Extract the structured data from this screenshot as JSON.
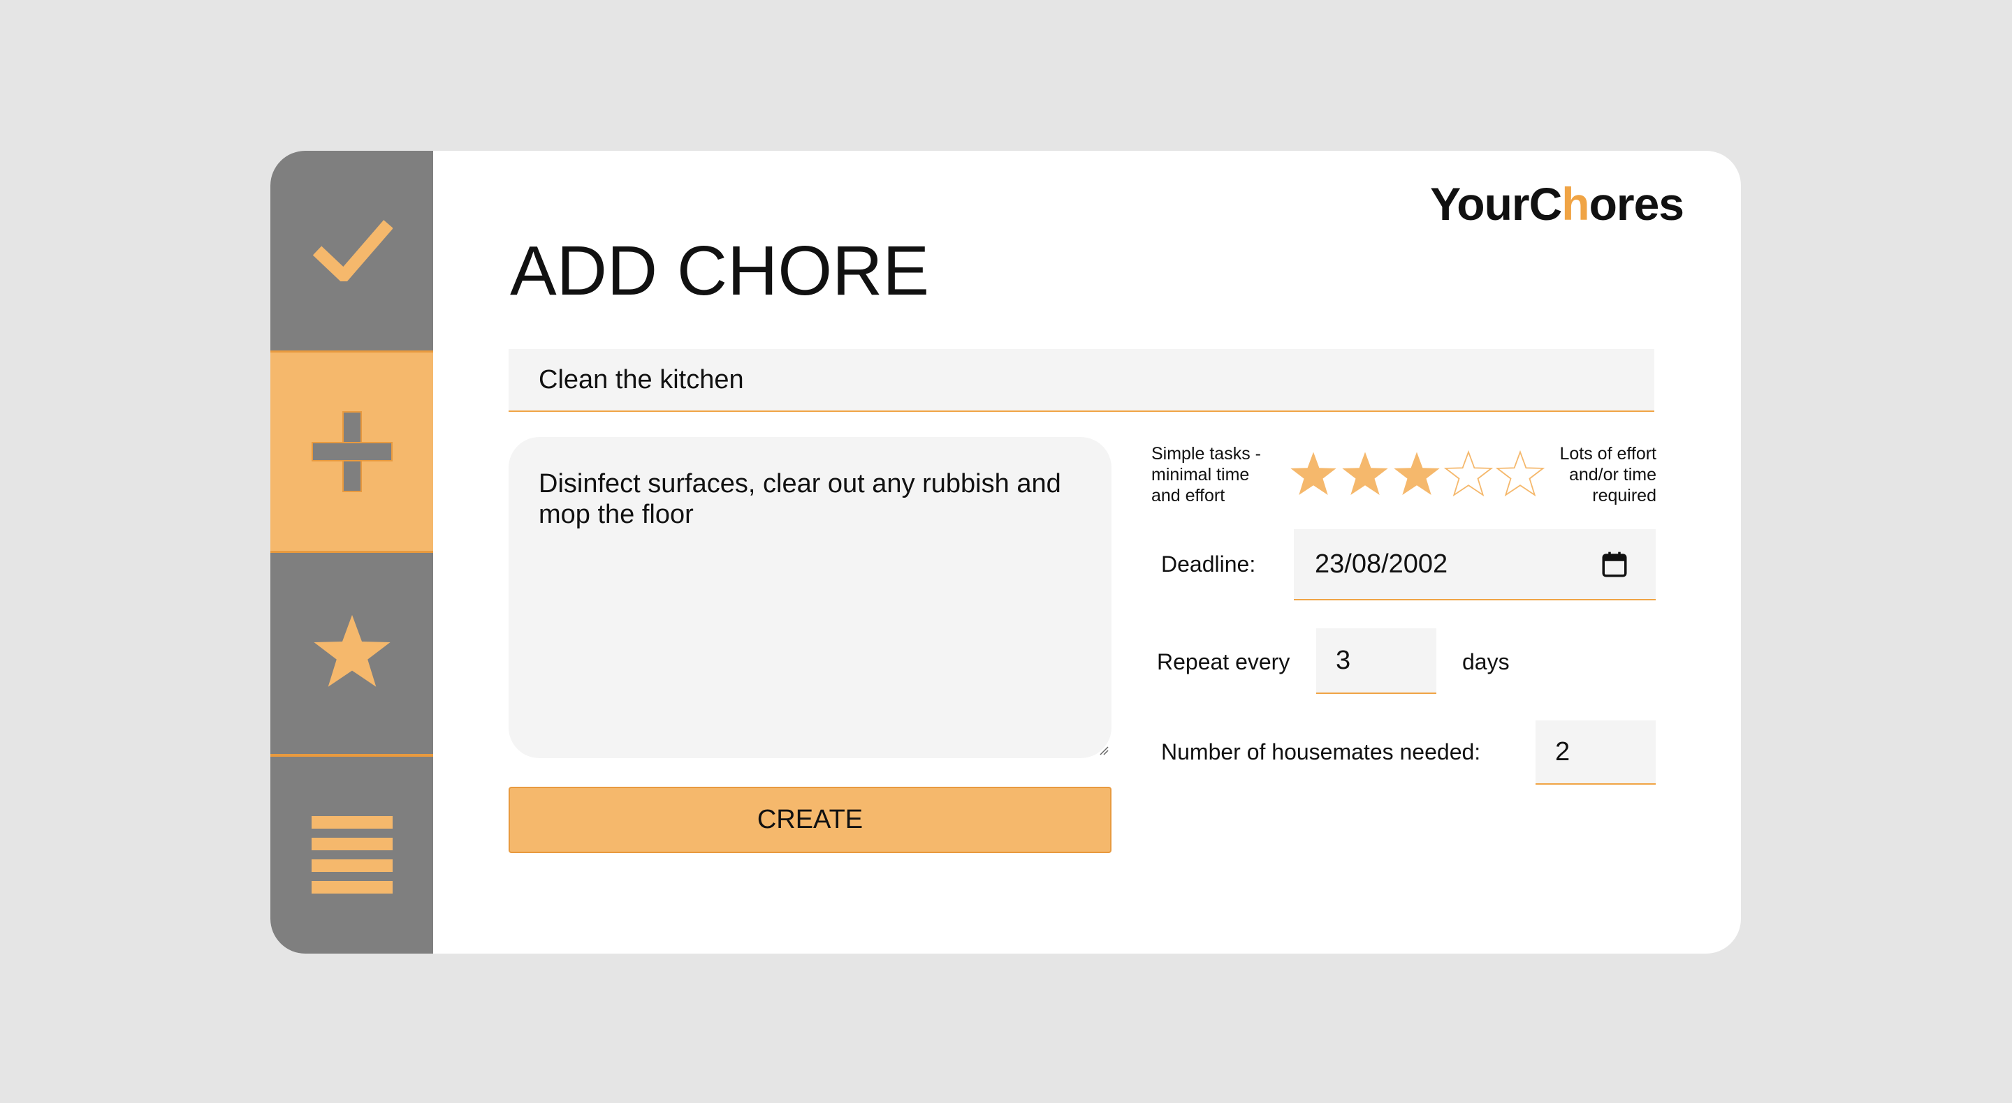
{
  "brand": {
    "logo_prefix": "YourC",
    "logo_highlight": "h",
    "logo_suffix": "ores",
    "accent_color": "#f5b86c",
    "sidebar_color": "#7f7f7f"
  },
  "sidebar": {
    "items": [
      {
        "icon": "check-icon",
        "active": false
      },
      {
        "icon": "plus-icon",
        "active": true
      },
      {
        "icon": "star-icon",
        "active": false
      },
      {
        "icon": "list-icon",
        "active": false
      }
    ]
  },
  "page": {
    "title": "ADD CHORE"
  },
  "form": {
    "name_value": "Clean the kitchen",
    "description_value": "Disinfect surfaces, clear out any rubbish and mop the floor",
    "create_label": "CREATE",
    "effort": {
      "low_label": "Simple tasks - minimal time and effort",
      "high_label": "Lots of effort and/or time required",
      "rating": 3,
      "max": 5
    },
    "deadline": {
      "label": "Deadline:",
      "value": "23/08/2002"
    },
    "repeat": {
      "label": "Repeat every",
      "value": "3",
      "unit": "days"
    },
    "housemates": {
      "label": "Number of housemates needed:",
      "value": "2"
    }
  }
}
